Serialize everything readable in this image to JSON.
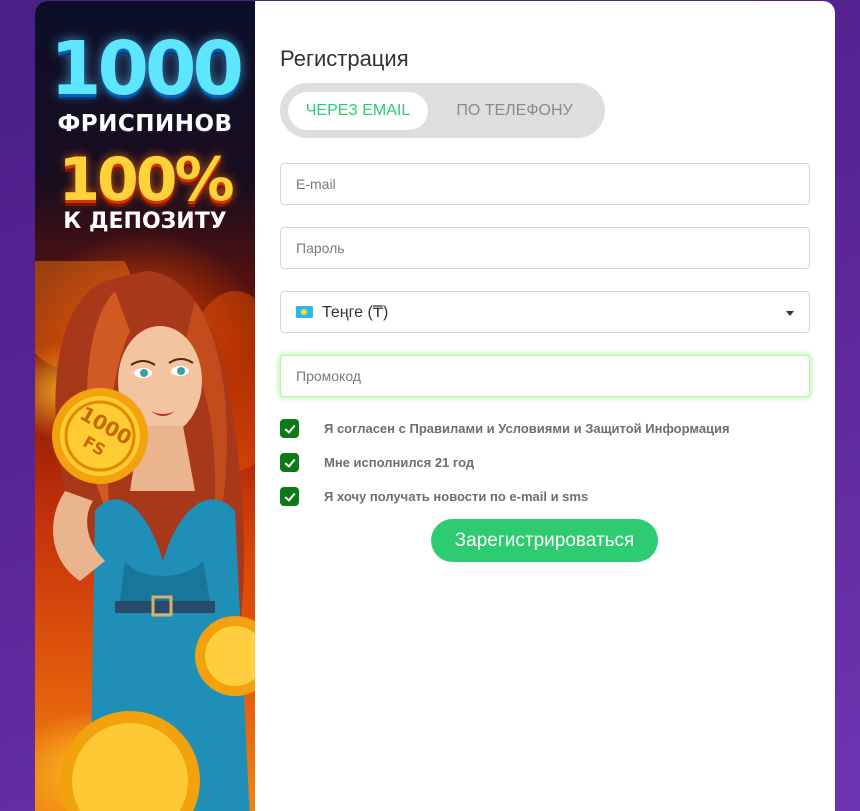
{
  "banner": {
    "number": "1000",
    "freespins": "ФРИСПИНОВ",
    "percent": "100%",
    "deposit": "К ДЕПОЗИТУ",
    "coin_text": "1000 FS"
  },
  "form": {
    "title": "Регистрация",
    "tabs": [
      {
        "label": "ЧЕРЕЗ EMAIL",
        "active": true
      },
      {
        "label": "ПО ТЕЛЕФОНУ",
        "active": false
      }
    ],
    "email_placeholder": "E-mail",
    "password_placeholder": "Пароль",
    "currency": {
      "selected": "Теңге (₸)",
      "icon": "kz-flag-icon"
    },
    "promo_placeholder": "Промокод",
    "checkboxes": [
      {
        "label": "Я согласен с Правилами и Условиями и Защитой Информация",
        "checked": true
      },
      {
        "label": "Мне исполнился 21 год",
        "checked": true
      },
      {
        "label": "Я хочу получать новости по e-mail и sms",
        "checked": true
      }
    ],
    "submit_label": "Зарегистрироваться"
  },
  "colors": {
    "accent": "#2ecc71",
    "checkbox": "#0c7a16",
    "background": "#5a2596"
  }
}
